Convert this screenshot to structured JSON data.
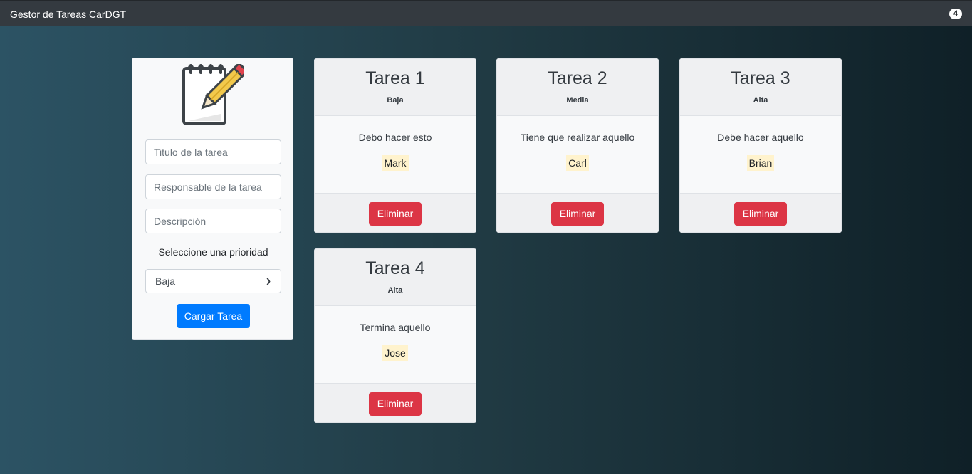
{
  "navbar": {
    "brand": "Gestor de Tareas CarDGT",
    "task_count": "4"
  },
  "form": {
    "title_placeholder": "Titulo de la tarea",
    "responsible_placeholder": "Responsable de la tarea",
    "description_placeholder": "Descripción",
    "priority_label": "Seleccione una prioridad",
    "priority_selected": "Baja",
    "submit_label": "Cargar Tarea"
  },
  "tasks": [
    {
      "title": "Tarea 1",
      "priority": "Baja",
      "description": "Debo hacer esto",
      "responsible": "Mark",
      "delete_label": "Eliminar"
    },
    {
      "title": "Tarea 2",
      "priority": "Media",
      "description": "Tiene que realizar aquello",
      "responsible": "Carl",
      "delete_label": "Eliminar"
    },
    {
      "title": "Tarea 3",
      "priority": "Alta",
      "description": "Debe hacer aquello",
      "responsible": "Brian",
      "delete_label": "Eliminar"
    },
    {
      "title": "Tarea 4",
      "priority": "Alta",
      "description": "Termina aquello",
      "responsible": "Jose",
      "delete_label": "Eliminar"
    }
  ],
  "colors": {
    "navbar": "#343a40",
    "primary": "#007bff",
    "danger": "#dc3545",
    "owner_highlight": "#fff3cd"
  },
  "icons": {
    "form_logo": "notepad-pencil-icon",
    "select_arrow": "chevron-down-icon"
  }
}
